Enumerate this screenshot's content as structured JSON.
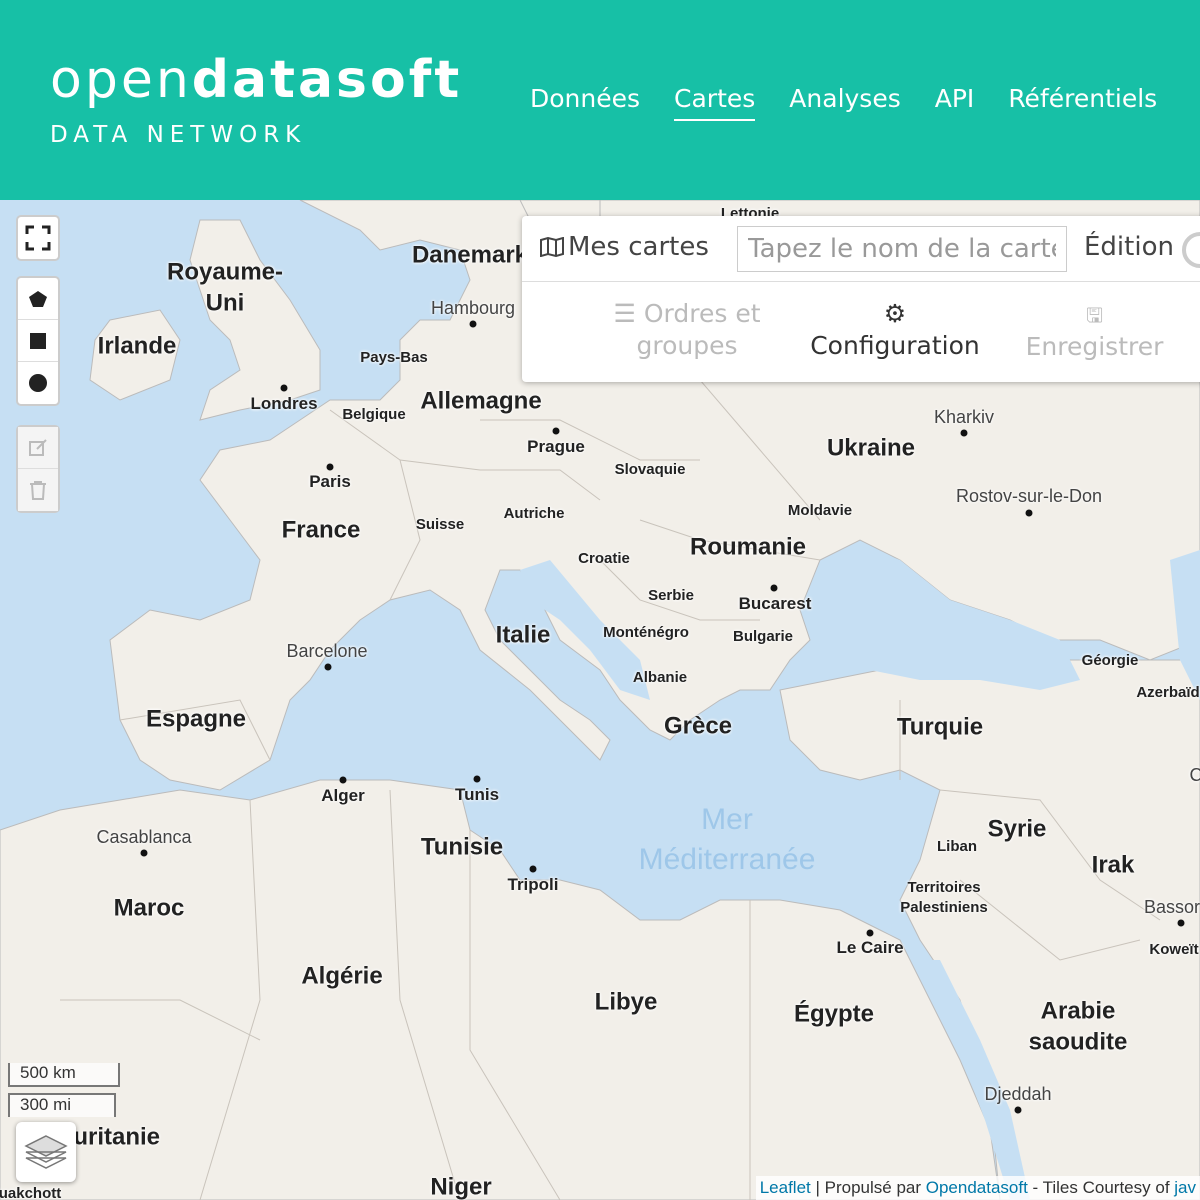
{
  "header": {
    "logo_thin": "open",
    "logo_bold": "datasoft",
    "logo_sub": "DATA NETWORK",
    "nav": [
      {
        "label": "Données",
        "active": false
      },
      {
        "label": "Cartes",
        "active": true
      },
      {
        "label": "Analyses",
        "active": false
      },
      {
        "label": "API",
        "active": false
      },
      {
        "label": "Référentiels",
        "active": false
      }
    ]
  },
  "panel": {
    "mes_cartes": "Mes cartes",
    "map_name_placeholder": "Tapez le nom de la carte",
    "edition": "Édition",
    "ordres_line1": "Ordres et",
    "ordres_line2": "groupes",
    "configuration": "Configuration",
    "enregistrer": "Enregistrer"
  },
  "scale": {
    "metric": "500 km",
    "imperial": "300 mi"
  },
  "attribution": {
    "leaflet": "Leaflet",
    "sep": " | Propulsé par ",
    "ods": "Opendatasoft",
    "tiles": " - Tiles Courtesy of ",
    "tail": "jav"
  },
  "places": {
    "lettonie": "Lettonie",
    "danemark": "Danemark",
    "royaume_uni_1": "Royaume-",
    "royaume_uni_2": "Uni",
    "irlande": "Irlande",
    "hambourg": "Hambourg",
    "pays_bas": "Pays-Bas",
    "londres": "Londres",
    "belgique": "Belgique",
    "allemagne": "Allemagne",
    "prague": "Prague",
    "paris": "Paris",
    "kharkiv": "Kharkiv",
    "ukraine": "Ukraine",
    "slovaquie": "Slovaquie",
    "rostov": "Rostov-sur-le-Don",
    "france": "France",
    "suisse": "Suisse",
    "autriche": "Autriche",
    "moldavie": "Moldavie",
    "croatie": "Croatie",
    "roumanie": "Roumanie",
    "serbie": "Serbie",
    "bucarest": "Bucarest",
    "barcelone": "Barcelone",
    "italie": "Italie",
    "montenegro": "Monténégro",
    "bulgarie": "Bulgarie",
    "georgie": "Géorgie",
    "albanie": "Albanie",
    "azerbaidjan": "Azerbaïd",
    "espagne": "Espagne",
    "grece": "Grèce",
    "turquie": "Turquie",
    "alger": "Alger",
    "tunis": "Tunis",
    "mer_1": "Mer",
    "mer_2": "Méditerranée",
    "casablanca": "Casablanca",
    "tunisie": "Tunisie",
    "liban": "Liban",
    "syrie": "Syrie",
    "irak": "Irak",
    "tripoli": "Tripoli",
    "territoires_1": "Territoires",
    "territoires_2": "Palestiniens",
    "bassora": "Bassor",
    "maroc": "Maroc",
    "koweit": "Koweït",
    "le_caire": "Le Caire",
    "algerie": "Algérie",
    "libye": "Libye",
    "egypte": "Égypte",
    "arabie_1": "Arabie",
    "arabie_2": "saoudite",
    "djeddah": "Djeddah",
    "mauritanie": "Mauritanie",
    "niger": "Niger",
    "nouakchott": "Nouakchott",
    "c_partial": "C"
  },
  "colors": {
    "header_bg": "#17c0a6",
    "land": "#f2efe9",
    "water": "#c6dff3"
  },
  "icons": {
    "fullscreen": "fullscreen-icon",
    "polygon": "polygon-icon",
    "rectangle": "rectangle-icon",
    "circle": "circle-icon",
    "edit": "edit-icon",
    "delete": "trash-icon",
    "layers": "layers-icon"
  }
}
